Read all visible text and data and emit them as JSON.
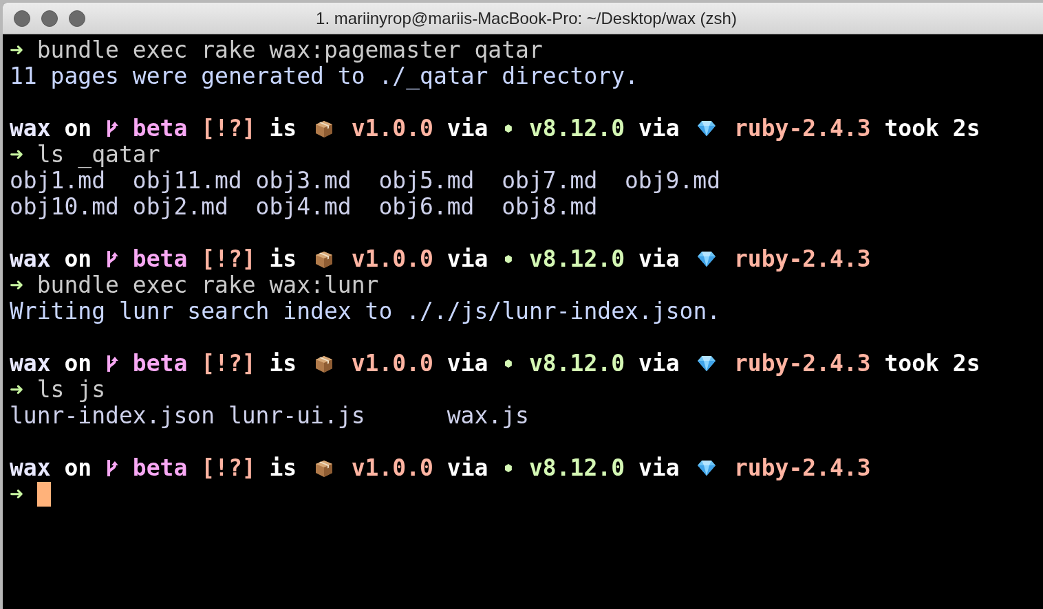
{
  "window": {
    "title": "1. mariinyrop@mariis-MacBook-Pro: ~/Desktop/wax (zsh)"
  },
  "lines": [
    {
      "kind": "command",
      "symbol": "➜",
      "text": "bundle exec rake wax:pagemaster qatar"
    },
    {
      "kind": "output",
      "text": "11 pages were generated to ./_qatar directory."
    },
    {
      "kind": "blank"
    },
    {
      "kind": "prompt",
      "segments": [
        {
          "kind": "text",
          "text": "wax",
          "color": "#e8e8ff"
        },
        {
          "kind": "text",
          "text": "on",
          "color": "#ffffff"
        },
        {
          "kind": "icon"
        },
        {
          "kind": "text",
          "text": "beta",
          "color": "#f8a8f4"
        },
        {
          "kind": "text",
          "text": "[!?]",
          "color": "#ffb4a2"
        },
        {
          "kind": "text",
          "text": "is",
          "color": "#ffffff"
        },
        {
          "kind": "icon"
        },
        {
          "kind": "text",
          "text": "v1.0.0",
          "color": "#ffb4a2"
        },
        {
          "kind": "text",
          "text": "via",
          "color": "#ffffff"
        },
        {
          "kind": "icon"
        },
        {
          "kind": "text",
          "text": "v8.12.0",
          "color": "#d4f7b4"
        },
        {
          "kind": "text",
          "text": "via",
          "color": "#ffffff"
        },
        {
          "kind": "icon"
        },
        {
          "kind": "text",
          "text": "ruby-2.4.3",
          "color": "#ffb4a2"
        },
        {
          "kind": "text",
          "text": "took 2s",
          "color": "#ffffff"
        }
      ]
    },
    {
      "kind": "command",
      "symbol": "➜",
      "text": "ls _qatar"
    },
    {
      "kind": "listing",
      "rows": [
        [
          "obj1.md",
          "obj11.md",
          "obj3.md",
          "obj5.md",
          "obj7.md",
          "obj9.md"
        ],
        [
          "obj10.md",
          "obj2.md",
          "obj4.md",
          "obj6.md",
          "obj8.md"
        ]
      ]
    },
    {
      "kind": "blank"
    },
    {
      "kind": "prompt",
      "segments": [
        {
          "kind": "text",
          "text": "wax",
          "color": "#e8e8ff"
        },
        {
          "kind": "text",
          "text": "on",
          "color": "#ffffff"
        },
        {
          "kind": "icon"
        },
        {
          "kind": "text",
          "text": "beta",
          "color": "#f8a8f4"
        },
        {
          "kind": "text",
          "text": "[!?]",
          "color": "#ffb4a2"
        },
        {
          "kind": "text",
          "text": "is",
          "color": "#ffffff"
        },
        {
          "kind": "icon"
        },
        {
          "kind": "text",
          "text": "v1.0.0",
          "color": "#ffb4a2"
        },
        {
          "kind": "text",
          "text": "via",
          "color": "#ffffff"
        },
        {
          "kind": "icon"
        },
        {
          "kind": "text",
          "text": "v8.12.0",
          "color": "#d4f7b4"
        },
        {
          "kind": "text",
          "text": "via",
          "color": "#ffffff"
        },
        {
          "kind": "icon"
        },
        {
          "kind": "text",
          "text": "ruby-2.4.3",
          "color": "#ffb4a2"
        }
      ]
    },
    {
      "kind": "command",
      "symbol": "➜",
      "text": "bundle exec rake wax:lunr"
    },
    {
      "kind": "output",
      "text": "Writing lunr search index to ././js/lunr-index.json."
    },
    {
      "kind": "blank"
    },
    {
      "kind": "prompt",
      "segments": [
        {
          "kind": "text",
          "text": "wax",
          "color": "#e8e8ff"
        },
        {
          "kind": "text",
          "text": "on",
          "color": "#ffffff"
        },
        {
          "kind": "icon"
        },
        {
          "kind": "text",
          "text": "beta",
          "color": "#f8a8f4"
        },
        {
          "kind": "text",
          "text": "[!?]",
          "color": "#ffb4a2"
        },
        {
          "kind": "text",
          "text": "is",
          "color": "#ffffff"
        },
        {
          "kind": "icon"
        },
        {
          "kind": "text",
          "text": "v1.0.0",
          "color": "#ffb4a2"
        },
        {
          "kind": "text",
          "text": "via",
          "color": "#ffffff"
        },
        {
          "kind": "icon"
        },
        {
          "kind": "text",
          "text": "v8.12.0",
          "color": "#d4f7b4"
        },
        {
          "kind": "text",
          "text": "via",
          "color": "#ffffff"
        },
        {
          "kind": "icon"
        },
        {
          "kind": "text",
          "text": "ruby-2.4.3",
          "color": "#ffb4a2"
        },
        {
          "kind": "text",
          "text": "took 2s",
          "color": "#ffffff"
        }
      ]
    },
    {
      "kind": "command",
      "symbol": "➜",
      "text": "ls js"
    },
    {
      "kind": "listing",
      "rows": [
        [
          "lunr-index.json",
          "lunr-ui.js",
          "wax.js"
        ]
      ]
    },
    {
      "kind": "blank"
    },
    {
      "kind": "prompt",
      "segments": [
        {
          "kind": "text",
          "text": "wax",
          "color": "#e8e8ff"
        },
        {
          "kind": "text",
          "text": "on",
          "color": "#ffffff"
        },
        {
          "kind": "icon"
        },
        {
          "kind": "text",
          "text": "beta",
          "color": "#f8a8f4"
        },
        {
          "kind": "text",
          "text": "[!?]",
          "color": "#ffb4a2"
        },
        {
          "kind": "text",
          "text": "is",
          "color": "#ffffff"
        },
        {
          "kind": "icon"
        },
        {
          "kind": "text",
          "text": "v1.0.0",
          "color": "#ffb4a2"
        },
        {
          "kind": "text",
          "text": "via",
          "color": "#ffffff"
        },
        {
          "kind": "icon"
        },
        {
          "kind": "text",
          "text": "v8.12.0",
          "color": "#d4f7b4"
        },
        {
          "kind": "text",
          "text": "via",
          "color": "#ffffff"
        },
        {
          "kind": "icon"
        },
        {
          "kind": "text",
          "text": "ruby-2.4.3",
          "color": "#ffb4a2"
        }
      ]
    },
    {
      "kind": "input",
      "symbol": "➜"
    }
  ]
}
